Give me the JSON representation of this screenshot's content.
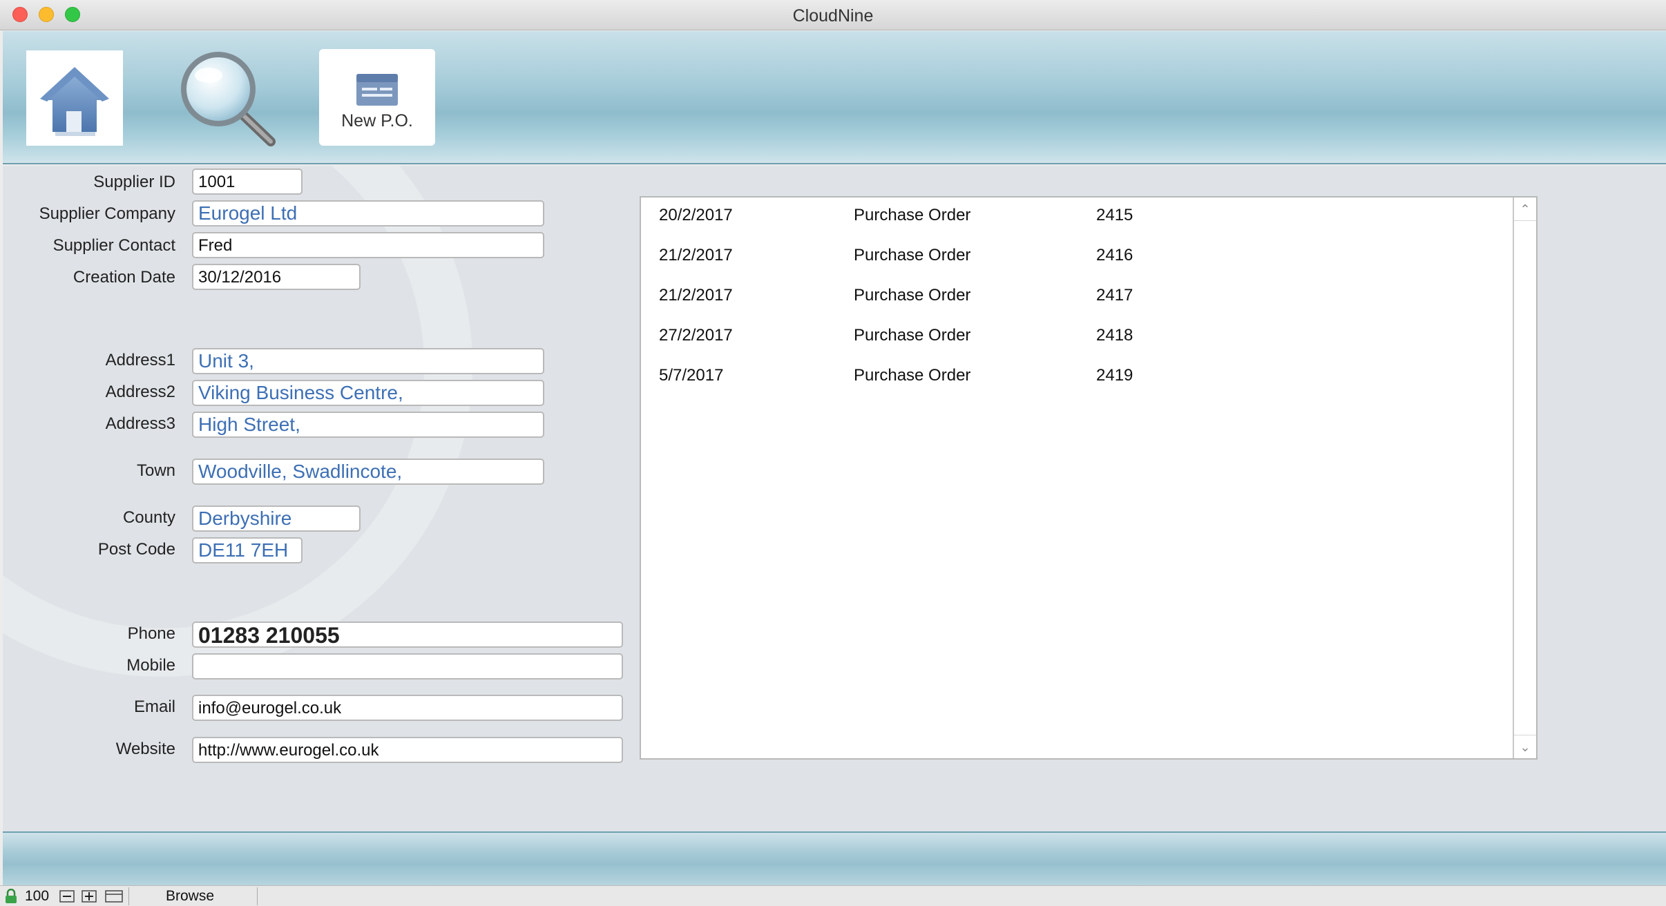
{
  "window": {
    "title": "CloudNine"
  },
  "toolbar": {
    "new_po_label": "New P.O."
  },
  "form": {
    "supplier_id": {
      "label": "Supplier ID",
      "value": "1001"
    },
    "supplier_company": {
      "label": "Supplier Company",
      "value": "Eurogel Ltd"
    },
    "supplier_contact": {
      "label": "Supplier Contact",
      "value": "Fred"
    },
    "creation_date": {
      "label": "Creation Date",
      "value": "30/12/2016"
    },
    "address1": {
      "label": "Address1",
      "value": "Unit 3,"
    },
    "address2": {
      "label": "Address2",
      "value": "Viking Business Centre,"
    },
    "address3": {
      "label": "Address3",
      "value": "High Street,"
    },
    "town": {
      "label": "Town",
      "value": "Woodville, Swadlincote,"
    },
    "county": {
      "label": "County",
      "value": "Derbyshire"
    },
    "post_code": {
      "label": "Post Code",
      "value": "DE11 7EH"
    },
    "phone": {
      "label": "Phone",
      "value": "01283 210055"
    },
    "mobile": {
      "label": "Mobile",
      "value": ""
    },
    "email": {
      "label": "Email",
      "value": "info@eurogel.co.uk"
    },
    "website": {
      "label": "Website",
      "value": "http://www.eurogel.co.uk"
    }
  },
  "orders": [
    {
      "date": "20/2/2017",
      "type": "Purchase Order",
      "number": "2415"
    },
    {
      "date": "21/2/2017",
      "type": "Purchase Order",
      "number": "2416"
    },
    {
      "date": "21/2/2017",
      "type": "Purchase Order",
      "number": "2417"
    },
    {
      "date": "27/2/2017",
      "type": "Purchase Order",
      "number": "2418"
    },
    {
      "date": "5/7/2017",
      "type": "Purchase Order",
      "number": "2419"
    }
  ],
  "statusbar": {
    "zoom": "100",
    "mode": "Browse"
  },
  "colors": {
    "accent": "#3d6fb4",
    "header": "#a6ccd9"
  }
}
